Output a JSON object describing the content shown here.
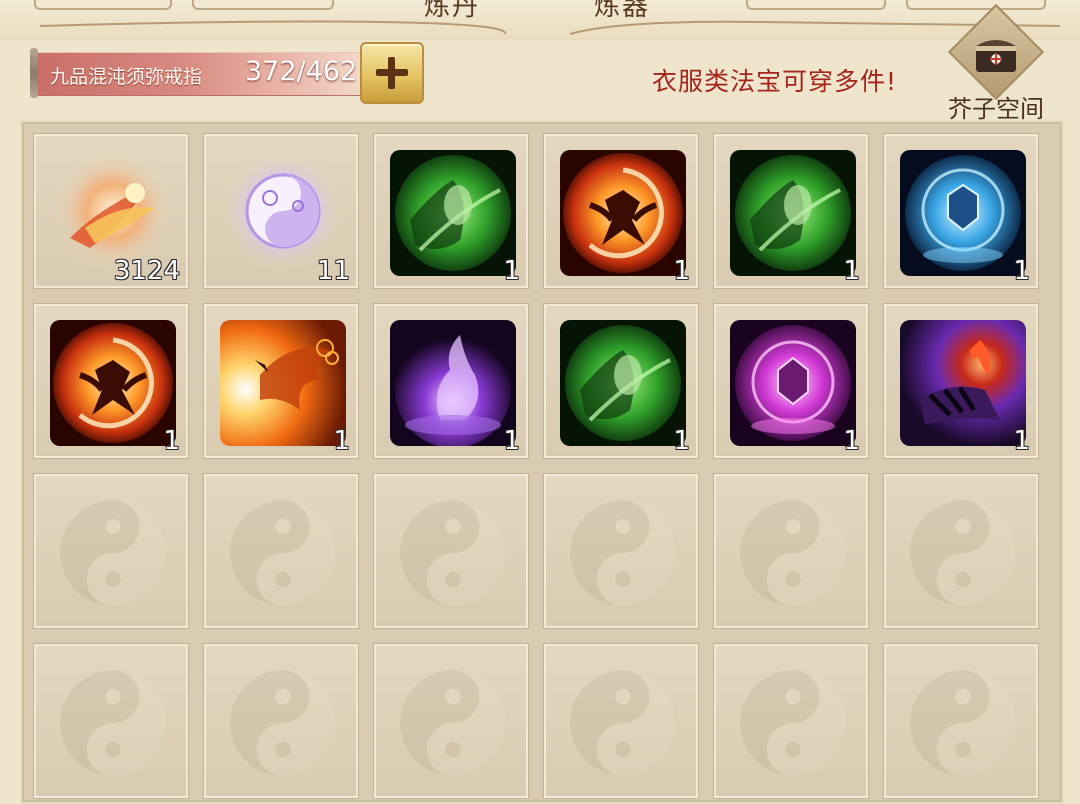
{
  "top_tabs": [
    {
      "title": "炼丹"
    },
    {
      "title": "炼器"
    }
  ],
  "ring": {
    "name": "九品混沌须弥戒指",
    "capacity": "372/462"
  },
  "add_button": {
    "icon": "plus-icon"
  },
  "notice": "衣服类法宝可穿多件!",
  "space_button": {
    "label": "芥子空间",
    "icon": "treasure-chest-icon"
  },
  "colors": {
    "background": "#efe4cc",
    "ring_bar": "#c96f68",
    "notice": "#a4251c",
    "slot": "#ddd0b7"
  },
  "inventory": {
    "columns": 6,
    "rows": 4,
    "items": [
      {
        "icon": "golden-fire-feather-icon",
        "count": "3124",
        "theme": "gold-orb"
      },
      {
        "icon": "spirit-taiji-orb-icon",
        "count": "11",
        "theme": "violet-orb"
      },
      {
        "icon": "green-spirit-icon",
        "count": "1",
        "theme": "green"
      },
      {
        "icon": "phoenix-icon",
        "count": "1",
        "theme": "phoenix"
      },
      {
        "icon": "green-spirit-icon",
        "count": "1",
        "theme": "green"
      },
      {
        "icon": "blue-crystal-orb-icon",
        "count": "1",
        "theme": "blue"
      },
      {
        "icon": "phoenix-icon",
        "count": "1",
        "theme": "phoenix"
      },
      {
        "icon": "fire-bird-icon",
        "count": "1",
        "theme": "firebird"
      },
      {
        "icon": "purple-flame-icon",
        "count": "1",
        "theme": "purple"
      },
      {
        "icon": "green-spirit-icon",
        "count": "1",
        "theme": "green"
      },
      {
        "icon": "magenta-crystal-orb-icon",
        "count": "1",
        "theme": "magenta"
      },
      {
        "icon": "purple-claw-flame-icon",
        "count": "1",
        "theme": "claw"
      }
    ],
    "empty_icon": "taiji-icon"
  }
}
